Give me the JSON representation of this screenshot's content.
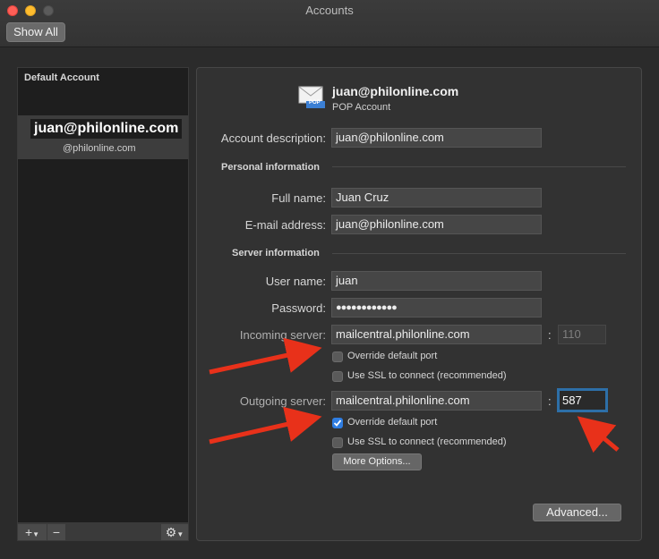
{
  "window": {
    "title": "Accounts",
    "show_all_label": "Show All"
  },
  "sidebar": {
    "header": "Default Account",
    "selected_account": {
      "email": "juan@philonline.com",
      "subtitle": "@philonline.com"
    },
    "toolbar": {
      "add_label": "+",
      "remove_label": "−"
    }
  },
  "account": {
    "email": "juan@philonline.com",
    "type": "POP Account",
    "icon_label": "POP"
  },
  "form": {
    "account_description": {
      "label": "Account description:",
      "value": "juan@philonline.com"
    },
    "personal_section": "Personal information",
    "full_name": {
      "label": "Full name:",
      "value": "Juan Cruz"
    },
    "email_address": {
      "label": "E-mail address:",
      "value": "juan@philonline.com"
    },
    "server_section": "Server information",
    "user_name": {
      "label": "User name:",
      "value": "juan"
    },
    "password": {
      "label": "Password:",
      "value": "●●●●●●●●●●●●"
    },
    "incoming_server": {
      "label": "Incoming server:",
      "value": "mailcentral.philonline.com",
      "port": "110"
    },
    "incoming_override": {
      "label": "Override default port",
      "checked": false
    },
    "incoming_ssl": {
      "label": "Use SSL to connect (recommended)",
      "checked": false
    },
    "outgoing_server": {
      "label": "Outgoing server:",
      "value": "mailcentral.philonline.com",
      "port": "587"
    },
    "outgoing_override": {
      "label": "Override default port",
      "checked": true
    },
    "outgoing_ssl": {
      "label": "Use SSL to connect (recommended)",
      "checked": false
    },
    "more_options_label": "More Options...",
    "advanced_label": "Advanced...",
    "colon": ":"
  },
  "colors": {
    "accent": "#2f7de1",
    "annotation_arrow": "#e8311a",
    "focus_ring": "#2d6fa8"
  }
}
